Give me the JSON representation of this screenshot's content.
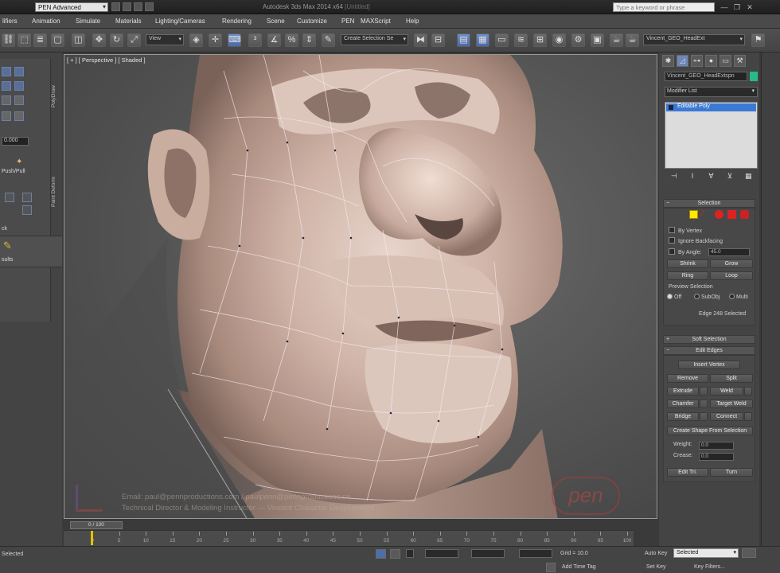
{
  "titlebar": {
    "workspace": "PEN Advanced",
    "app_title": "Autodesk 3ds Max 2014 x64",
    "app_title_tail": "  [Untitled]",
    "search_placeholder": "Type a keyword or phrase",
    "min": "—",
    "max": "❐",
    "close": "✕"
  },
  "menu": {
    "items": [
      "lifiers",
      "Animation",
      "Simulate",
      "Materials",
      "Lighting/Cameras",
      "Rendering",
      "Scene",
      "Customize",
      "PEN",
      "MAXScript",
      "Help"
    ]
  },
  "toolbar": {
    "selection_filter": "View",
    "named_selection": "Create Selection Se",
    "object_select": "Vincent_GEO_HeadExt"
  },
  "leftpanel": {
    "value_field": "0.000",
    "push_pull_label": "Push/Pull",
    "tab_polydraw": "PolyDraw",
    "tab_paint_deform": "Paint Deform",
    "ck_label": "ck",
    "results_label": "sults"
  },
  "viewport": {
    "label": "[ + ] [ Perspective ] [ Shaded ]",
    "watermark_email": "Email: paul@pennproductions.com / paulpenn@pennproductions.ca",
    "watermark_line2": "Technical Director & Modeling Instructor  —  Vincent Character Development",
    "pen_logo": "pen"
  },
  "cmdpanel": {
    "object_name": "Vincent_GEO_HeadExtspn",
    "object_color": "#28b88c",
    "modifier_list": "Modifier List",
    "stack_item": "Editable Poly",
    "selection": {
      "title": "Selection",
      "by_vertex": "By Vertex",
      "ignore_backfacing": "Ignore Backfacing",
      "by_angle": "By Angle:",
      "by_angle_value": "45.0",
      "shrink": "Shrink",
      "grow": "Grow",
      "ring": "Ring",
      "loop": "Loop",
      "preview_label": "Preview Selection",
      "preview_off": "Off",
      "preview_subobj": "SubObj",
      "preview_multi": "Multi",
      "status": "Edge 248 Selected"
    },
    "soft_selection": {
      "title": "Soft Selection"
    },
    "edit_edges": {
      "title": "Edit Edges",
      "insert_vertex": "Insert Vertex",
      "remove": "Remove",
      "split": "Split",
      "extrude": "Extrude",
      "weld": "Weld",
      "chamfer": "Chamfer",
      "target_weld": "Target Weld",
      "bridge": "Bridge",
      "connect": "Connect",
      "create_shape": "Create Shape From Selection",
      "weight": "Weight:",
      "weight_value": "0.0",
      "crease": "Crease:",
      "crease_value": "0.0",
      "edit_tri": "Edit Tri.",
      "turn": "Turn"
    }
  },
  "timeline": {
    "slider": "0 / 100",
    "ticks": [
      0,
      5,
      10,
      15,
      20,
      25,
      30,
      35,
      40,
      45,
      50,
      55,
      60,
      65,
      70,
      75,
      80,
      85,
      90,
      95,
      100
    ]
  },
  "statusbar": {
    "selected": "Selected",
    "grid": "Grid = 10.0",
    "auto_key": "Auto Key",
    "set_key": "Set Key",
    "key_mode": "Selected",
    "key_filters": "Key Filters...",
    "add_time_tag": "Add Time Tag"
  }
}
